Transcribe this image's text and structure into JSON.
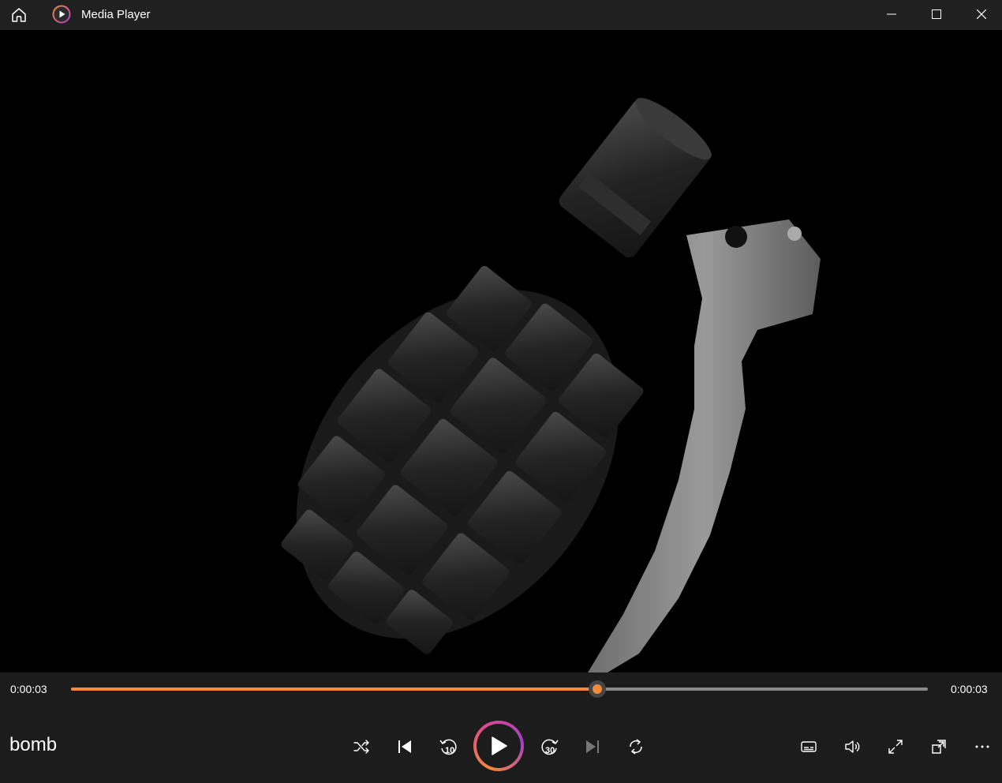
{
  "window": {
    "title": "Media Player",
    "icons": {
      "home": "home-icon",
      "logo": "media-player-logo",
      "minimize": "minimize-icon",
      "maximize": "maximize-icon",
      "close": "close-icon"
    }
  },
  "video": {
    "subject": "grenade"
  },
  "playback": {
    "current_time": "0:00:03",
    "total_time": "0:00:03",
    "progress_fraction": 0.614,
    "accent_color": "#f28a3c",
    "track_title": "bomb",
    "state": "paused"
  },
  "controls": {
    "shuffle": "shuffle-icon",
    "previous": "previous-icon",
    "rewind": "rewind-10-icon",
    "rewind_label": "10",
    "play": "play-icon",
    "forward": "forward-30-icon",
    "forward_label": "30",
    "next": "next-icon",
    "repeat": "repeat-icon",
    "captions": "captions-icon",
    "volume": "volume-icon",
    "fullscreen": "fullscreen-icon",
    "mini_player": "mini-player-icon",
    "more": "more-icon"
  }
}
